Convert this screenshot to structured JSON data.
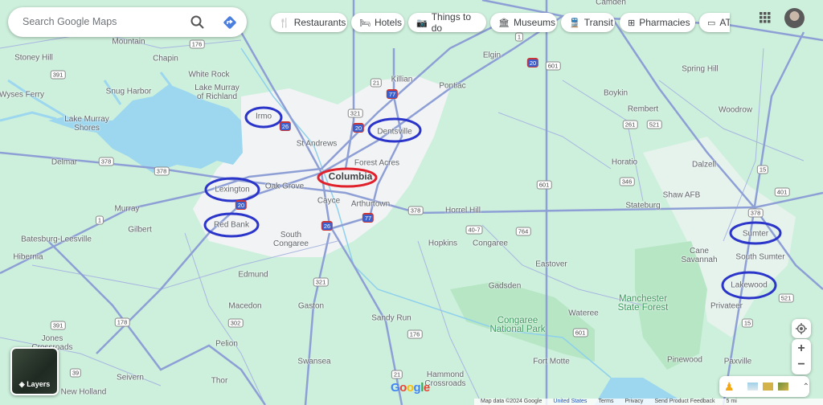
{
  "search": {
    "placeholder": "Search Google Maps",
    "search_icon": "search-icon",
    "directions_icon": "directions-icon"
  },
  "chips": [
    {
      "label": "Restaurants",
      "icon": "🍴"
    },
    {
      "label": "Hotels",
      "icon": "🛏"
    },
    {
      "label": "Things to do",
      "icon": "📷"
    },
    {
      "label": "Museums",
      "icon": "🏛"
    },
    {
      "label": "Transit",
      "icon": "🚆"
    },
    {
      "label": "Pharmacies",
      "icon": "⊞"
    },
    {
      "label": "ATM",
      "icon": "▭"
    }
  ],
  "colors": {
    "land": "#cdf0dc",
    "water": "#9cd7ef",
    "road": "#8e9fd6",
    "urban": "#f1f3f4",
    "park": "#b6e6c4",
    "circle_blue": "#2b35c9",
    "circle_red": "#e0202a"
  },
  "places": {
    "camden": "Camden",
    "mountain": "Mountain",
    "chapin": "Chapin",
    "stoney_hill": "Stoney Hill",
    "white_rock": "White Rock",
    "lake_murray_richland": "Lake Murray of Richland",
    "snug_harbor": "Snug Harbor",
    "wyses_ferry": "Wyses Ferry",
    "lake_murray_shores": "Lake Murray Shores",
    "irmo": "Irmo",
    "st_andrews": "St Andrews",
    "delmar": "Delmar",
    "lexington": "Lexington",
    "oak_grove": "Oak Grove",
    "columbia": "Columbia",
    "forest_acres": "Forest Acres",
    "dentsville": "Dentsville",
    "killian": "Killian",
    "elgin": "Elgin",
    "pontiac": "Pontiac",
    "cayce": "Cayce",
    "arthurtown": "Arthurtown",
    "murray": "Murray",
    "gilbert": "Gilbert",
    "red_bank": "Red Bank",
    "batesburg": "Batesburg-Leesville",
    "hibernia": "Hibernia",
    "south_congaree": "South Congaree",
    "edmund": "Edmund",
    "macedon": "Macedon",
    "gaston": "Gaston",
    "sandy_run": "Sandy Run",
    "pelion": "Pelion",
    "swansea": "Swansea",
    "jones_crossroads": "Jones Crossroads",
    "seivern": "Seivern",
    "thor": "Thor",
    "new_holland": "New Holland",
    "hammond_crossroads": "Hammond Crossroads",
    "horrel_hill": "Horrel Hill",
    "hopkins": "Hopkins",
    "congaree": "Congaree",
    "eastover": "Eastover",
    "gadsden": "Gadsden",
    "wateree": "Wateree",
    "congaree_np": "Congaree National Park",
    "fort_motte": "Fort Motte",
    "manchester": "Manchester State Forest",
    "pinewood": "Pinewood",
    "paxville": "Paxville",
    "privateer": "Privateer",
    "lakewood": "Lakewood",
    "south_sumter": "South Sumter",
    "cane_savannah": "Cane Savannah",
    "sumter": "Sumter",
    "stateburg": "Stateburg",
    "shaw_afb": "Shaw AFB",
    "dalzell": "Dalzell",
    "horatio": "Horatio",
    "rembert": "Rembert",
    "boykin": "Boykin",
    "spring_hill": "Spring Hill",
    "woodrow": "Woodrow"
  },
  "shields": {
    "us176": "176",
    "sc391": "391",
    "us378a": "378",
    "us378b": "378",
    "us21": "21",
    "i77a": "77",
    "us321": "321",
    "i20a": "20",
    "i26a": "26",
    "us1a": "1",
    "i20b": "20",
    "i20c": "20",
    "us601a": "601",
    "us601b": "601",
    "us378c": "378",
    "sc261": "261",
    "us521a": "521",
    "sc346": "346",
    "us15": "15",
    "us401": "401",
    "i26b": "26",
    "i77b": "77",
    "sc764": "764",
    "sc407": "40-7",
    "us378d": "378",
    "us521b": "521",
    "us15b": "15",
    "us601c": "601",
    "us178": "178",
    "sc302": "302",
    "us321b": "321",
    "us21b": "21",
    "sc39": "39",
    "sc391b": "391",
    "us1b": "1",
    "us176b": "176"
  },
  "layers": {
    "label": "Layers"
  },
  "logo": "Google",
  "footer": {
    "map_data": "Map data ©2024 Google",
    "country": "United States",
    "terms": "Terms",
    "privacy": "Privacy",
    "feedback": "Send Product Feedback",
    "scale": "5 mi"
  }
}
